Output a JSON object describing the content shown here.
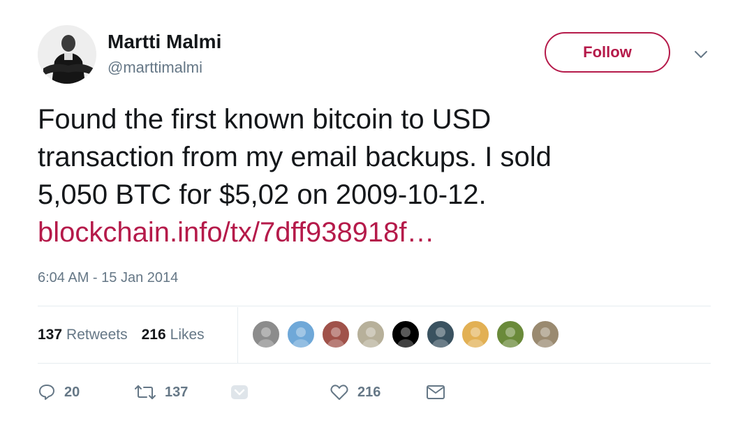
{
  "user": {
    "name": "Martti Malmi",
    "handle": "@marttimalmi"
  },
  "follow": {
    "label": "Follow"
  },
  "tweet": {
    "lines": [
      "Found the first known bitcoin to USD",
      "transaction from my email backups. I sold",
      "5,050 BTC for $5,02 on 2009-10-12."
    ],
    "link_text": "blockchain.info/tx/7dff938918f…",
    "timestamp": "6:04 AM - 15 Jan 2014"
  },
  "stats": {
    "retweets_count": "137",
    "retweets_label": "Retweets",
    "likes_count": "216",
    "likes_label": "Likes"
  },
  "likers": [
    {
      "color": "#8c8c8c"
    },
    {
      "color": "#6fa8d8"
    },
    {
      "color": "#a0524a"
    },
    {
      "color": "#b7b09a"
    },
    {
      "color": "#000000"
    },
    {
      "color": "#3a5260"
    },
    {
      "color": "#e2b054"
    },
    {
      "color": "#6a8a3a"
    },
    {
      "color": "#9a8a70"
    }
  ],
  "actions": {
    "reply_count": "20",
    "retweet_count": "137",
    "like_count": "216"
  },
  "colors": {
    "accent": "#b51a4a",
    "text": "#14171a",
    "muted": "#657786",
    "border": "#e6ecf0"
  }
}
